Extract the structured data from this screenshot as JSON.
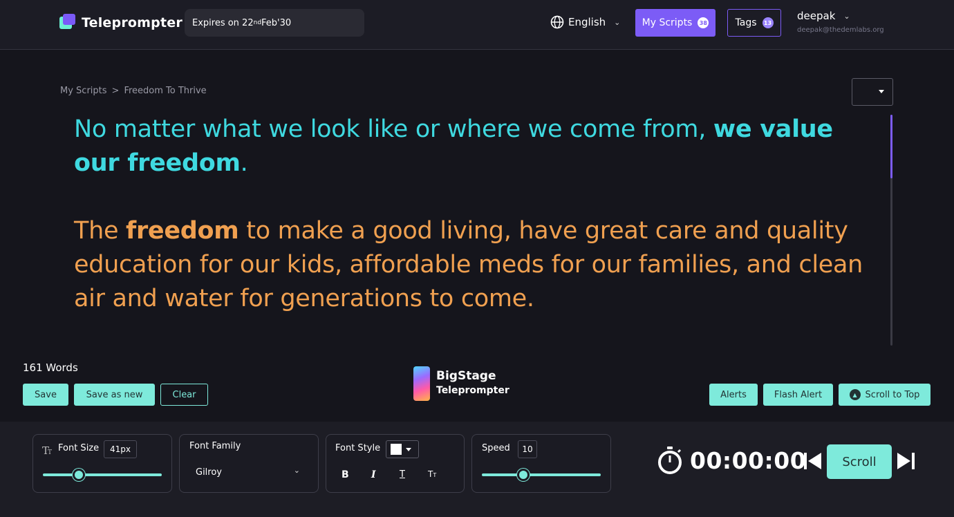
{
  "header": {
    "app_name": "Teleprompter",
    "expires_prefix": "Expires on 22",
    "expires_sup": "nd",
    "expires_suffix": " Feb'30",
    "language": "English",
    "my_scripts_label": "My Scripts",
    "my_scripts_count": "38",
    "tags_label": "Tags",
    "tags_count": "13",
    "user_name": "deepak",
    "user_email": "deepak@thedemlabs.org"
  },
  "breadcrumb": {
    "root": "My Scripts",
    "separator": ">",
    "current": "Freedom To Thrive"
  },
  "script": {
    "p1_a": "No matter what we look like or where we come from, ",
    "p1_bold": "we value our freedom",
    "p1_end": ".",
    "p2_a": "The ",
    "p2_bold": "freedom",
    "p2_b": " to make a good living, have great care and quality education for our kids, affordable meds for our families, and clean air and water for generations to come.",
    "p1_color": "#3fd9e0",
    "p2_color": "#f0a050"
  },
  "actions": {
    "word_count": "161 Words",
    "save": "Save",
    "save_as_new": "Save as new",
    "clear": "Clear",
    "alerts": "Alerts",
    "flash_alert": "Flash Alert",
    "scroll_to_top": "Scroll to Top"
  },
  "brand": {
    "line1": "BigStage",
    "line2": "Teleprompter"
  },
  "controls": {
    "font_size_label": "Font Size",
    "font_size_value": "41px",
    "font_size_level": 0.3,
    "font_family_label": "Font Family",
    "font_family_value": "Gilroy",
    "font_style_label": "Font Style",
    "text_color": "#ffffff",
    "speed_label": "Speed",
    "speed_value": "10",
    "speed_level": 0.35
  },
  "timer": {
    "time": "00:00:00",
    "scroll_label": "Scroll"
  },
  "colors": {
    "accent": "#7c5cf6",
    "mint": "#7eeadb"
  }
}
